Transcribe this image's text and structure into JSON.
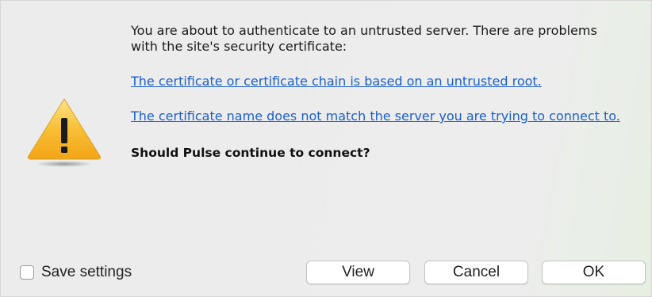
{
  "dialog": {
    "intro": "You are about to authenticate to an untrusted server.  There are problems with the site's security certificate:",
    "links": [
      "The certificate or certificate chain is based on an untrusted root.",
      "The certificate name does not match the server you are trying to connect to."
    ],
    "question": "Should Pulse continue to connect?"
  },
  "footer": {
    "save_settings_label": "Save settings",
    "save_settings_checked": false,
    "view_label": "View",
    "cancel_label": "Cancel",
    "ok_label": "OK"
  },
  "icons": {
    "warning": "warning-triangle-icon"
  },
  "colors": {
    "link": "#1a5fd0",
    "warning_fill": "#f6b62c"
  }
}
